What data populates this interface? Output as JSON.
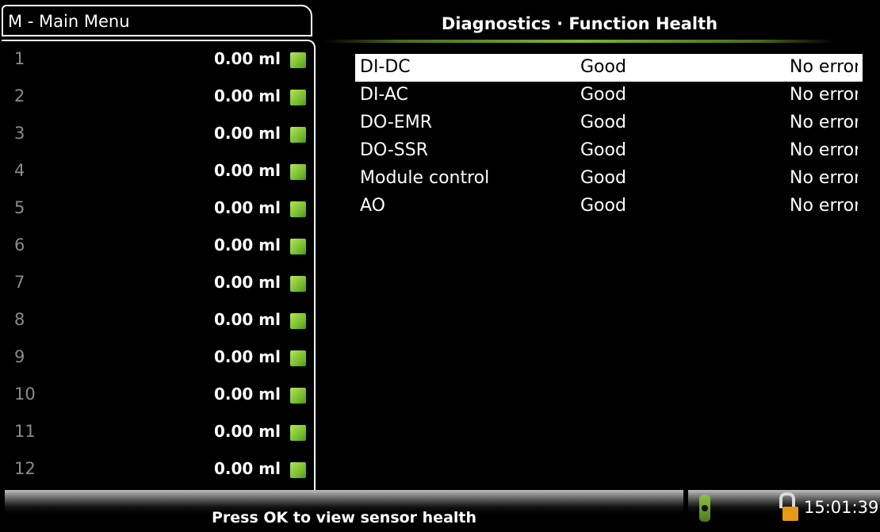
{
  "menu": {
    "title": "M - Main Menu"
  },
  "channels": [
    {
      "num": "1",
      "value": "0.00 ml"
    },
    {
      "num": "2",
      "value": "0.00 ml"
    },
    {
      "num": "3",
      "value": "0.00 ml"
    },
    {
      "num": "4",
      "value": "0.00 ml"
    },
    {
      "num": "5",
      "value": "0.00 ml"
    },
    {
      "num": "6",
      "value": "0.00 ml"
    },
    {
      "num": "7",
      "value": "0.00 ml"
    },
    {
      "num": "8",
      "value": "0.00 ml"
    },
    {
      "num": "9",
      "value": "0.00 ml"
    },
    {
      "num": "10",
      "value": "0.00 ml"
    },
    {
      "num": "11",
      "value": "0.00 ml"
    },
    {
      "num": "12",
      "value": "0.00 ml"
    }
  ],
  "diagnostics": {
    "title": "Diagnostics · Function Health",
    "rows": [
      {
        "name": "DI-DC",
        "status": "Good",
        "error": "No error"
      },
      {
        "name": "DI-AC",
        "status": "Good",
        "error": "No error"
      },
      {
        "name": "DO-EMR",
        "status": "Good",
        "error": "No error"
      },
      {
        "name": "DO-SSR",
        "status": "Good",
        "error": "No error"
      },
      {
        "name": "Module control",
        "status": "Good",
        "error": "No error"
      },
      {
        "name": "AO",
        "status": "Good",
        "error": "No error"
      }
    ]
  },
  "footer": {
    "message": "Press OK to view sensor health"
  },
  "status": {
    "time": "15:01:39",
    "device_icon": "device-icon",
    "lock_icon": "unlocked-lock-icon"
  },
  "colors": {
    "indicator": "#8cc63f",
    "lock": "#e49a12",
    "selected_bg": "#ffffff"
  }
}
